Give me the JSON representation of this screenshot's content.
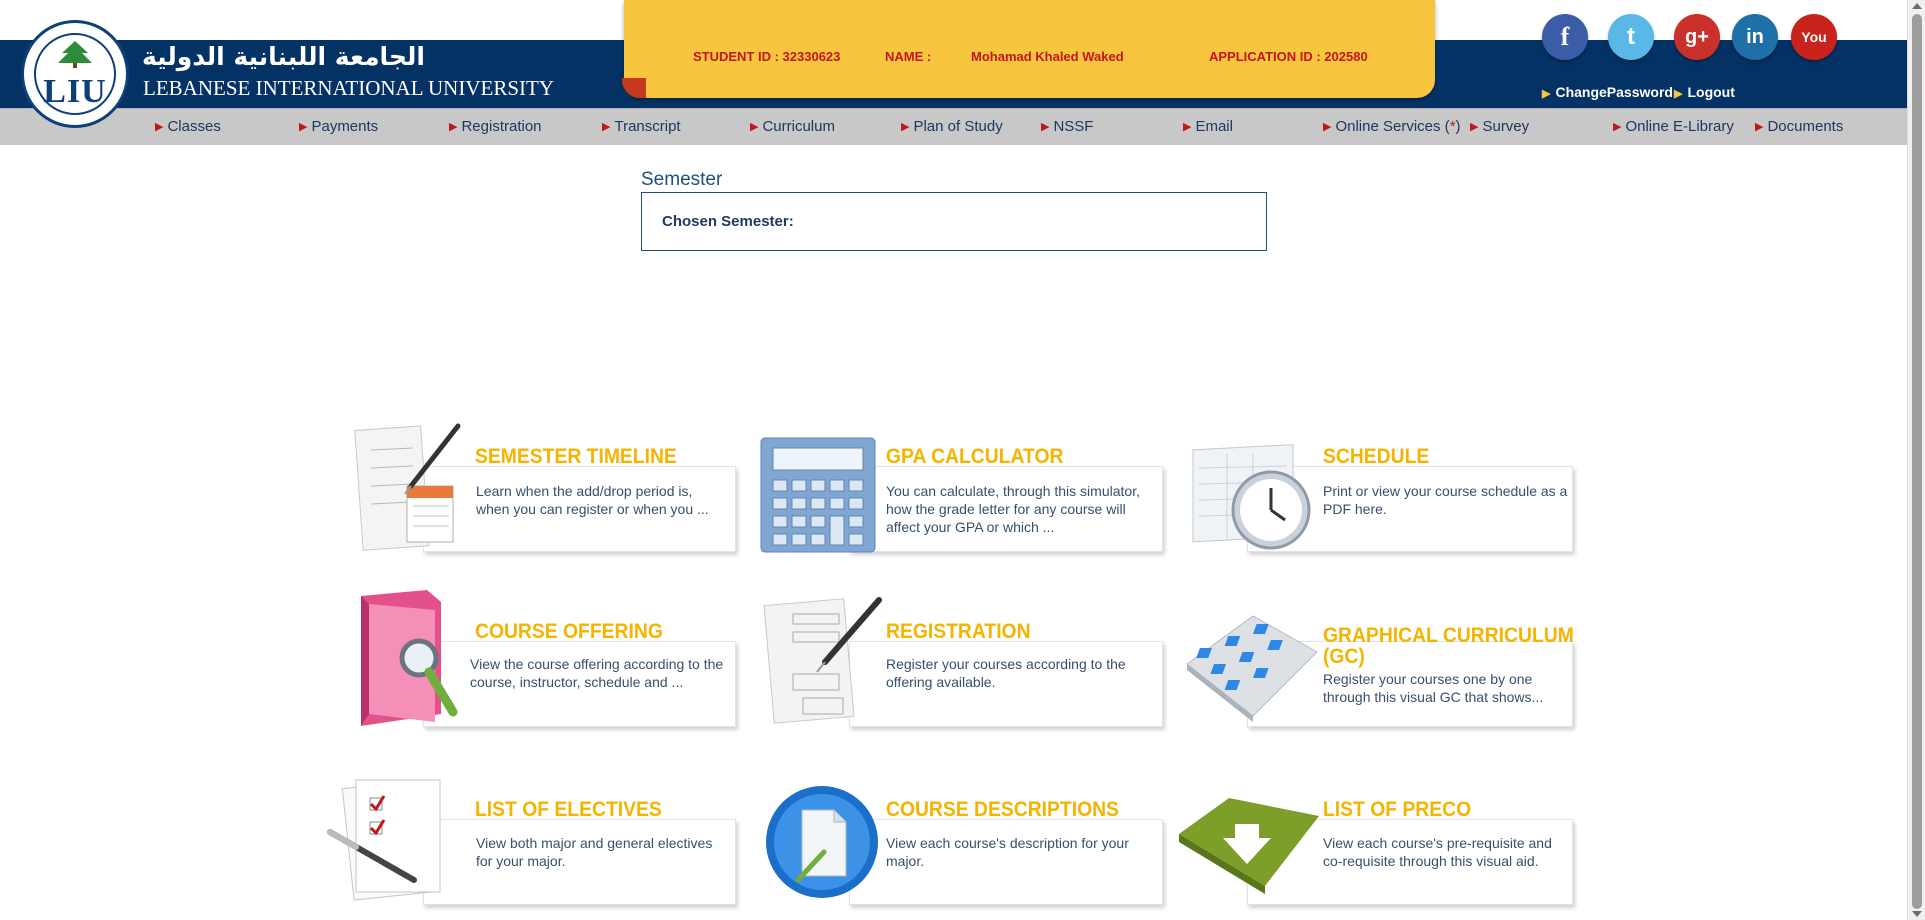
{
  "header": {
    "logo_text": "LIU",
    "university_arabic": "الجامعة اللبنانية الدولية",
    "university_english": "LEBANESE INTERNATIONAL UNIVERSITY"
  },
  "student": {
    "student_id_label": "STUDENT ID : 32330623",
    "name_label": "NAME :",
    "name_value": "Mohamad Khaled Waked",
    "application_id_label": "APPLICATION ID : 202580"
  },
  "social": {
    "facebook": "f",
    "twitter": "t",
    "googleplus": "g+",
    "linkedin": "in",
    "youtube": "You"
  },
  "account": {
    "change_password": "ChangePassword",
    "logout": "Logout"
  },
  "nav": {
    "classes": "Classes",
    "payments": "Payments",
    "registration": "Registration",
    "transcript": "Transcript",
    "curriculum": "Curriculum",
    "plan_of_study": "Plan of Study",
    "nssf": "NSSF",
    "email": "Email",
    "online_services": "Online Services (",
    "online_services_star": "*",
    "online_services_close": ")",
    "survey": "Survey",
    "online_elibrary": "Online E-Library",
    "documents": "Documents"
  },
  "semester": {
    "title": "Semester",
    "chosen_label": "Chosen Semester:"
  },
  "tiles": {
    "semester_timeline": {
      "title": "SEMESTER TIMELINE",
      "desc": "Learn when the add/drop period is, when you can register or when you ..."
    },
    "gpa_calculator": {
      "title": "GPA CALCULATOR",
      "desc": "You can calculate, through this simulator, how the grade letter for any course will affect your GPA or which ..."
    },
    "schedule": {
      "title": "SCHEDULE",
      "desc": "Print or view your course schedule as a PDF here."
    },
    "course_offering": {
      "title": "COURSE OFFERING",
      "desc": "View the course offering according to the course, instructor, schedule and ..."
    },
    "registration": {
      "title": "REGISTRATION",
      "desc": "Register your courses according to the offering available."
    },
    "graphical_curriculum": {
      "title": "GRAPHICAL CURRICULUM (GC)",
      "title_line1": "GRAPHICAL CURRICULUM",
      "title_line2": "(GC)",
      "desc": "Register your courses one by one through this visual GC that shows..."
    },
    "list_of_electives": {
      "title": "LIST OF ELECTIVES",
      "desc": "View both major and general electives for your major."
    },
    "course_descriptions": {
      "title": "COURSE DESCRIPTIONS",
      "desc": "View each course's description for your major."
    },
    "list_of_preco": {
      "title": "LIST OF PRECO",
      "desc": "View each course's pre-requisite and co-requisite through this visual aid."
    }
  },
  "icons": {
    "semester_timeline": "document-pen-calendar-icon",
    "gpa_calculator": "calculator-icon",
    "schedule": "schedule-clock-icon",
    "course_offering": "folder-magnifier-icon",
    "registration": "form-pen-icon",
    "graphical_curriculum": "grid-board-icon",
    "list_of_electives": "checklist-pen-icon",
    "course_descriptions": "document-globe-icon",
    "list_of_preco": "green-folder-arrow-icon"
  },
  "colors": {
    "header_blue": "#053265",
    "panel_yellow": "#f8c63e",
    "accent_red": "#c4161c",
    "tile_title": "#f4b400",
    "nav_gray": "#c8c8c8"
  }
}
